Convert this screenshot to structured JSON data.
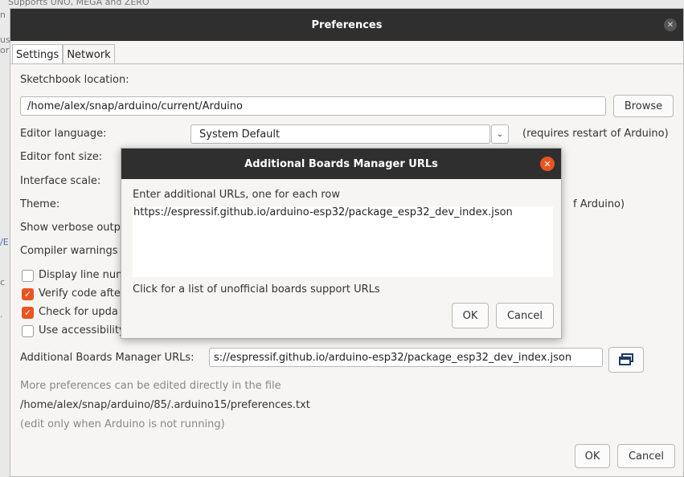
{
  "background": {
    "top_text": "Supports UNO, MEGA and ZERO",
    "left_fragments": [
      "n",
      "us",
      "or",
      "/E",
      "c",
      "."
    ]
  },
  "window": {
    "title": "Preferences",
    "tabs": [
      {
        "label": "Settings",
        "active": true
      },
      {
        "label": "Network",
        "active": false
      }
    ],
    "sketchbook_label": "Sketchbook location:",
    "sketchbook_value": "/home/alex/snap/arduino/current/Arduino",
    "browse_label": "Browse",
    "editor_language_label": "Editor language:",
    "editor_language_value": "System Default",
    "restart_note": "(requires restart of Arduino)",
    "editor_font_label": "Editor font size:",
    "interface_scale_label": "Interface scale:",
    "theme_label": "Theme:",
    "theme_note_fragment": "f Arduino)",
    "verbose_label": "Show verbose outp",
    "compiler_warnings_label": "Compiler warnings",
    "checkboxes": [
      {
        "label": "Display line num",
        "checked": false
      },
      {
        "label": "Verify code afte",
        "checked": true
      },
      {
        "label": "Check for upda",
        "checked": true
      },
      {
        "label": "Use accessibility",
        "checked": false
      }
    ],
    "boards_urls_label": "Additional Boards Manager URLs:",
    "boards_urls_value": "s://espressif.github.io/arduino-esp32/package_esp32_dev_index.json",
    "more_prefs_note": "More preferences can be edited directly in the file",
    "prefs_path": "/home/alex/snap/arduino/85/.arduino15/preferences.txt",
    "edit_note": "(edit only when Arduino is not running)",
    "ok_label": "OK",
    "cancel_label": "Cancel"
  },
  "dialog": {
    "title": "Additional Boards Manager URLs",
    "instruction": "Enter additional URLs, one for each row",
    "urls_text": "https://espressif.github.io/arduino-esp32/package_esp32_dev_index.json",
    "link_text": "Click for a list of unofficial boards support URLs",
    "ok_label": "OK",
    "cancel_label": "Cancel"
  },
  "colors": {
    "accent": "#e95420",
    "titlebar": "#2f2f2f"
  },
  "icons": {
    "window_close": "close-icon",
    "dialog_close": "close-icon",
    "urls_editor": "window-stack-icon",
    "dropdown": "chevron-down-icon",
    "check": "check-icon"
  }
}
